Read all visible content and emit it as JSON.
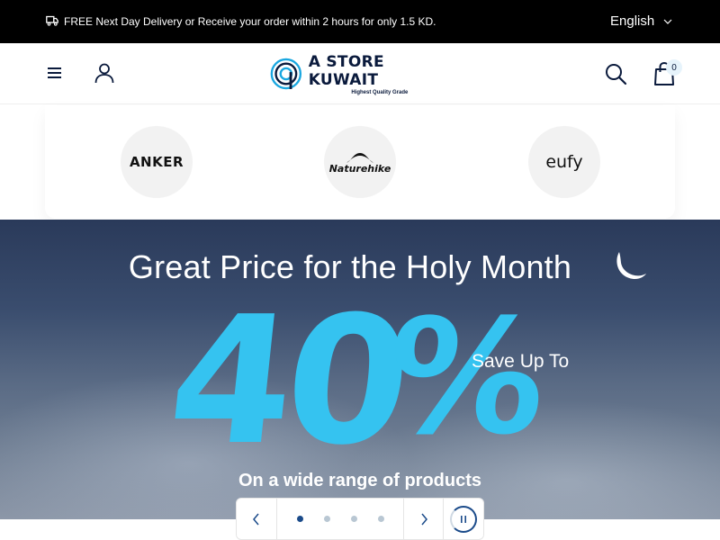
{
  "announcement": {
    "text": "FREE Next Day Delivery or Receive your order within 2 hours for only 1.5 KD.",
    "icon": "truck-icon"
  },
  "language": {
    "selected": "English"
  },
  "header": {
    "logo_name": "A STORE KUWAIT",
    "logo_tagline": "Highest Quality Grade",
    "cart_count": "0"
  },
  "brands": [
    {
      "name": "ANKER"
    },
    {
      "name": "Naturehike"
    },
    {
      "name": "eufy"
    }
  ],
  "hero": {
    "headline": "Great Price for the Holy Month",
    "discount_number": "40",
    "discount_symbol": "%",
    "save_label": "Save Up To",
    "subheadline": "On a wide range of products"
  },
  "slider": {
    "slide_count": 4,
    "active_slide": 1
  },
  "colors": {
    "topbar_bg": "#000000",
    "accent_blue": "#35c3f0",
    "brand_navy": "#0a1a3c",
    "active_dot": "#1b4b8a"
  }
}
